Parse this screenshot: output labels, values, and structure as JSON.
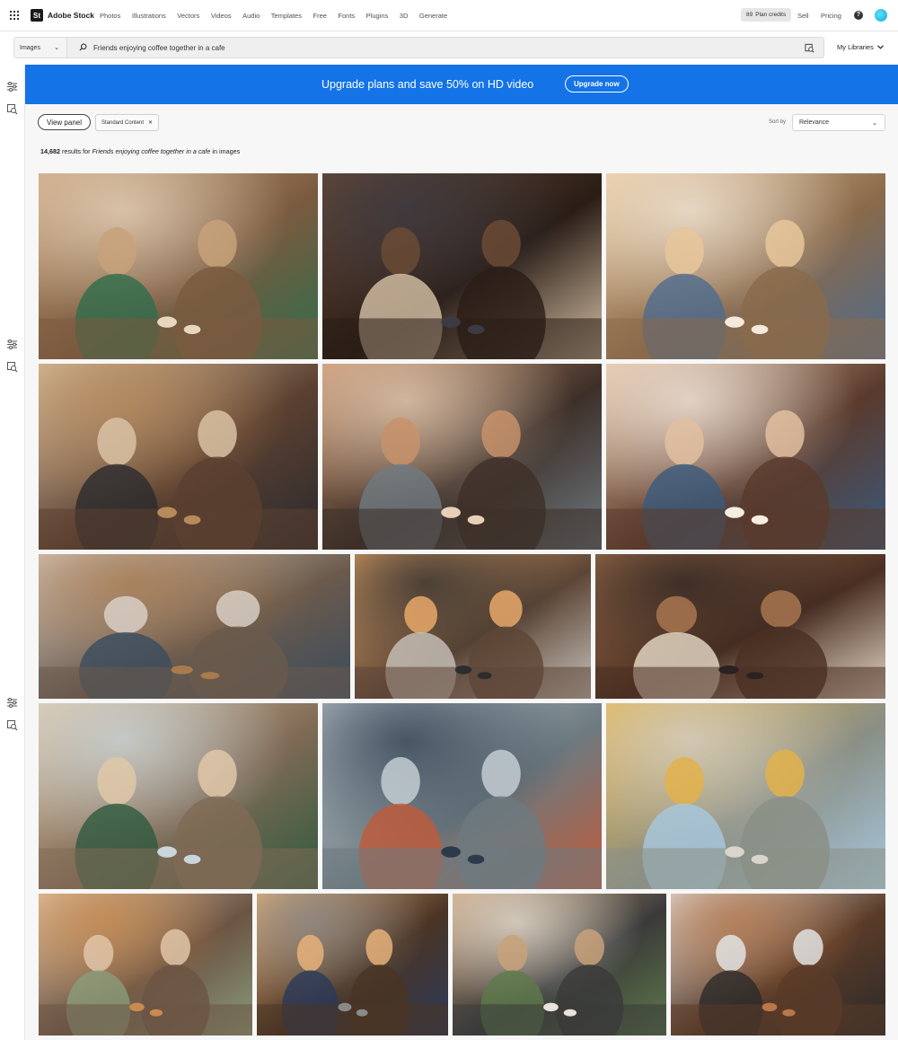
{
  "app": {
    "logo_mark": "St",
    "logo_text": "Adobe Stock"
  },
  "nav": {
    "items": [
      "Photos",
      "Illustrations",
      "Vectors",
      "Videos",
      "Audio",
      "Templates",
      "Free",
      "Fonts",
      "Plugins",
      "3D",
      "Generate"
    ],
    "credits_count": "89",
    "credits_label": "Plan credits",
    "sell": "Sell",
    "pricing": "Pricing",
    "help_glyph": "?"
  },
  "search": {
    "type_value": "Images",
    "query": "Friends enjoying coffee together in a cafe",
    "my_libraries": "My Libraries"
  },
  "banner": {
    "text": "Upgrade plans and save 50% on HD video",
    "button": "Upgrade now",
    "color": "#1473e6"
  },
  "filters": {
    "view_panel": "View panel",
    "chip": "Standard Content",
    "sort_label": "Sort by",
    "sort_value": "Relevance"
  },
  "results": {
    "count": "14,682",
    "prefix": "results for",
    "query": "Friends enjoying coffee together in a cafe",
    "suffix": "in images"
  },
  "photos": [
    {
      "name": "photo-friends-laughing-cafe-table",
      "palette": [
        "#7a5a3f",
        "#c8a27a",
        "#2f6d4c",
        "#e9d6bf"
      ]
    },
    {
      "name": "photo-hands-holding-latte-cups",
      "palette": [
        "#2a1d16",
        "#6b4a35",
        "#d8c3a8",
        "#3b3b44"
      ]
    },
    {
      "name": "photo-two-women-laughing-coffee",
      "palette": [
        "#8a6a4a",
        "#e8c79a",
        "#4d6b8f",
        "#f3e9dc"
      ]
    },
    {
      "name": "photo-group-talking-industrial-cafe",
      "palette": [
        "#5b4030",
        "#d9c2a5",
        "#2a2a2e",
        "#b88a5a"
      ]
    },
    {
      "name": "photo-smiling-man-beard-cafe",
      "palette": [
        "#3d2f28",
        "#c7926b",
        "#6f7a82",
        "#e8d0b8"
      ]
    },
    {
      "name": "photo-women-cheering-lattes",
      "palette": [
        "#5a3a2c",
        "#e2bfa0",
        "#3a5a7d",
        "#f5ece2"
      ]
    },
    {
      "name": "photo-friends-at-counter-window",
      "palette": [
        "#6a5a4c",
        "#d8cfc6",
        "#3a4c5e",
        "#a97a4e"
      ]
    },
    {
      "name": "photo-friends-selfie-coffee",
      "palette": [
        "#5c4636",
        "#e8a86a",
        "#c9c3bc",
        "#2d2d2d"
      ]
    },
    {
      "name": "photo-cappuccino-toast-table",
      "palette": [
        "#4a2f22",
        "#a87650",
        "#e9dcc9",
        "#2b2220"
      ]
    },
    {
      "name": "photo-four-friends-tablet-cafe",
      "palette": [
        "#7f6a55",
        "#e0c8a8",
        "#2e5a3e",
        "#c9d6dc"
      ]
    },
    {
      "name": "photo-couple-outdoor-cafe-blur",
      "palette": [
        "#6d7a80",
        "#c3cdd2",
        "#c25a38",
        "#2c3a4c"
      ]
    },
    {
      "name": "photo-two-women-hats-outdoor",
      "palette": [
        "#8a8f85",
        "#e3b24a",
        "#a7c8e0",
        "#d9d4cc"
      ]
    },
    {
      "name": "photo-seniors-laughing-cafe",
      "palette": [
        "#6b5443",
        "#e0c6a8",
        "#8a9c7a",
        "#c98a4e"
      ]
    },
    {
      "name": "photo-two-women-smiling-cups",
      "palette": [
        "#4a3424",
        "#e6b27a",
        "#2a3a5a",
        "#8a8a8a"
      ]
    },
    {
      "name": "photo-women-chatting-cafe-window",
      "palette": [
        "#3a3a3a",
        "#c9a27a",
        "#5e7a4a",
        "#e8e2d8"
      ]
    },
    {
      "name": "photo-hands-coffee-wooden-table",
      "palette": [
        "#5a3b28",
        "#e3e3e3",
        "#2a2a2a",
        "#b8784a"
      ]
    }
  ]
}
